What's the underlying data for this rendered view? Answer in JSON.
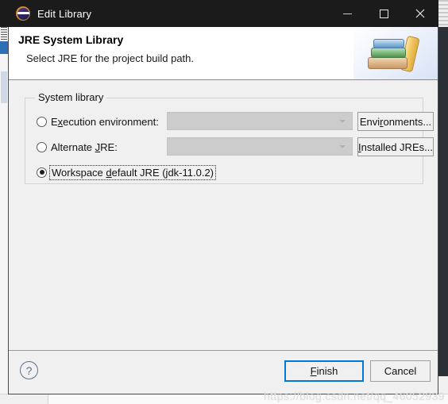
{
  "window": {
    "title": "Edit Library",
    "app_icon": "eclipse-icon",
    "controls": {
      "minimize": "minimize-icon",
      "maximize": "maximize-icon",
      "close": "close-icon"
    }
  },
  "header": {
    "title": "JRE System Library",
    "subtitle": "Select JRE for the project build path.",
    "banner_icon": "books-icon"
  },
  "group": {
    "label": "System library",
    "options": [
      {
        "id": "execution-environment",
        "label_before": "E",
        "mnemonic": "x",
        "label_after": "ecution environment:",
        "selected": false,
        "has_combo": true,
        "combo_value": "",
        "side_button": {
          "before": "Envi",
          "mnemonic": "r",
          "after": "onments..."
        }
      },
      {
        "id": "alternate-jre",
        "label_before": "Alternate ",
        "mnemonic": "J",
        "label_after": "RE:",
        "selected": false,
        "has_combo": true,
        "combo_value": "",
        "side_button": {
          "before": "",
          "mnemonic": "I",
          "after": "nstalled JREs..."
        }
      },
      {
        "id": "workspace-default-jre",
        "label_before": "Workspace ",
        "mnemonic": "d",
        "label_after": "efault JRE (jdk-11.0.2)",
        "selected": true,
        "has_combo": false,
        "combo_value": "",
        "side_button": null
      }
    ]
  },
  "footer": {
    "help": "?",
    "finish": {
      "mnemonic": "F",
      "after": "inish"
    },
    "cancel": "Cancel",
    "default_button_color": "#0078d7"
  },
  "watermark": "https://blog.csdn.net/qq_46052939"
}
